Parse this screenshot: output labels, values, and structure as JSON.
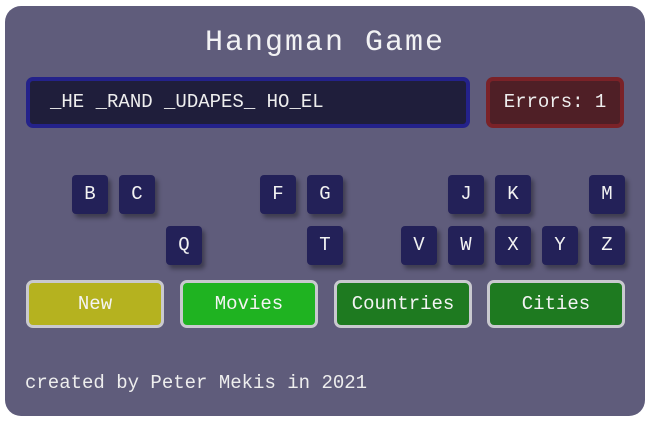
{
  "game": {
    "title": "Hangman Game",
    "word_display": "_HE _RAND _UDAPES_ HO_EL",
    "errors_text": "Errors: 1"
  },
  "letters": [
    {
      "label": "B"
    },
    {
      "label": "C"
    },
    {
      "label": "F"
    },
    {
      "label": "G"
    },
    {
      "label": "J"
    },
    {
      "label": "K"
    },
    {
      "label": "M"
    },
    {
      "label": "Q"
    },
    {
      "label": "T"
    },
    {
      "label": "V"
    },
    {
      "label": "W"
    },
    {
      "label": "X"
    },
    {
      "label": "Y"
    },
    {
      "label": "Z"
    }
  ],
  "categories": [
    {
      "label": "New",
      "color": "#b5b21f"
    },
    {
      "label": "Movies",
      "color": "#1fb321"
    },
    {
      "label": "Countries",
      "color": "#1e7a20"
    },
    {
      "label": "Cities",
      "color": "#1e7a20"
    }
  ],
  "footer": {
    "credit": "created by Peter Mekis in 2021"
  },
  "colors": {
    "panel_bg": "#5f5c7b",
    "letter_bg": "#232158",
    "word_border": "#24228a",
    "errors_border": "#7a2228"
  }
}
